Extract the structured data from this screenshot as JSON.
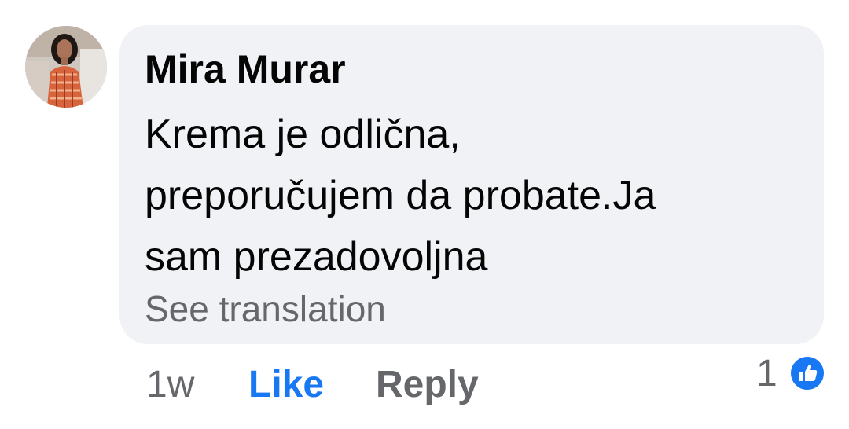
{
  "comment": {
    "author": "Mira Murar",
    "text_lines": [
      "Krema je odlična,",
      "preporučujem da probate.Ja",
      "sam prezadovoljna"
    ],
    "see_translation": "See translation",
    "time": "1w",
    "like_label": "Like",
    "reply_label": "Reply",
    "reaction_count": "1",
    "reaction_icon": "thumbs-up-icon"
  },
  "colors": {
    "bubble_bg": "#f0f2f5",
    "like_blue": "#1877f2",
    "secondary_text": "#65676b",
    "primary_text": "#050505"
  }
}
